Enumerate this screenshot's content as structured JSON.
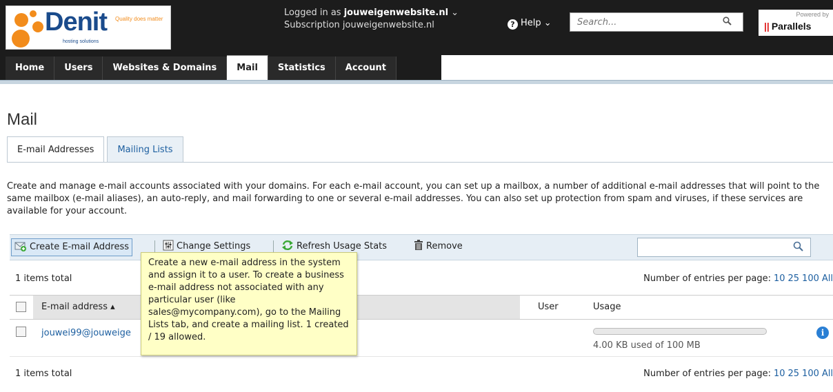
{
  "header": {
    "logo_name": "Denit",
    "logo_tagline": "Quality does matter",
    "logo_sub": "hosting solutions",
    "logged_in_label": "Logged in as",
    "logged_in_user": "jouweigenwebsite.nl",
    "subscription_label": "Subscription",
    "subscription_value": "jouweigenwebsite.nl",
    "help_label": "Help",
    "search_placeholder": "Search...",
    "powered_by": "Powered by",
    "powered_brand": "Parallels"
  },
  "nav": {
    "items": [
      {
        "label": "Home"
      },
      {
        "label": "Users"
      },
      {
        "label": "Websites & Domains"
      },
      {
        "label": "Mail"
      },
      {
        "label": "Statistics"
      },
      {
        "label": "Account"
      }
    ],
    "active": "Mail"
  },
  "page": {
    "title": "Mail",
    "tabs": [
      {
        "label": "E-mail Addresses"
      },
      {
        "label": "Mailing Lists"
      }
    ],
    "description": "Create and manage e-mail accounts associated with your domains. For each e-mail account, you can set up a mailbox, a number of additional e-mail addresses that will point to the same mailbox (e-mail aliases), an auto-reply, and mail forwarding to one or several e-mail addresses. You can also set up protection from spam and viruses, if these services are available for your account."
  },
  "toolbar": {
    "create_label": "Create E-mail Address",
    "settings_label": "Change Settings",
    "refresh_label": "Refresh Usage Stats",
    "remove_label": "Remove"
  },
  "tooltip": {
    "text": "Create a new e-mail address in the system and assign it to a user. To create a business e-mail address not associated with any particular user (like sales@mycompany.com), go to the Mailing Lists tab, and create a mailing list. 1 created / 19 allowed."
  },
  "list": {
    "total": "1 items total",
    "per_page_label": "Number of entries per page:",
    "per_page_options": [
      "10",
      "25",
      "100",
      "All"
    ],
    "columns": {
      "email": "E-mail address ▴",
      "user": "User",
      "usage": "Usage"
    },
    "rows": [
      {
        "email": "jouwei99@jouweige",
        "usage_text": "4.00 KB used of 100 MB",
        "usage_fraction": 4e-05
      }
    ]
  },
  "colors": {
    "accent": "#1d5fa0",
    "header_bg": "#1c1c1c",
    "tooltip_bg": "#ffffc6",
    "toolbar_bg": "#e6eef5"
  }
}
